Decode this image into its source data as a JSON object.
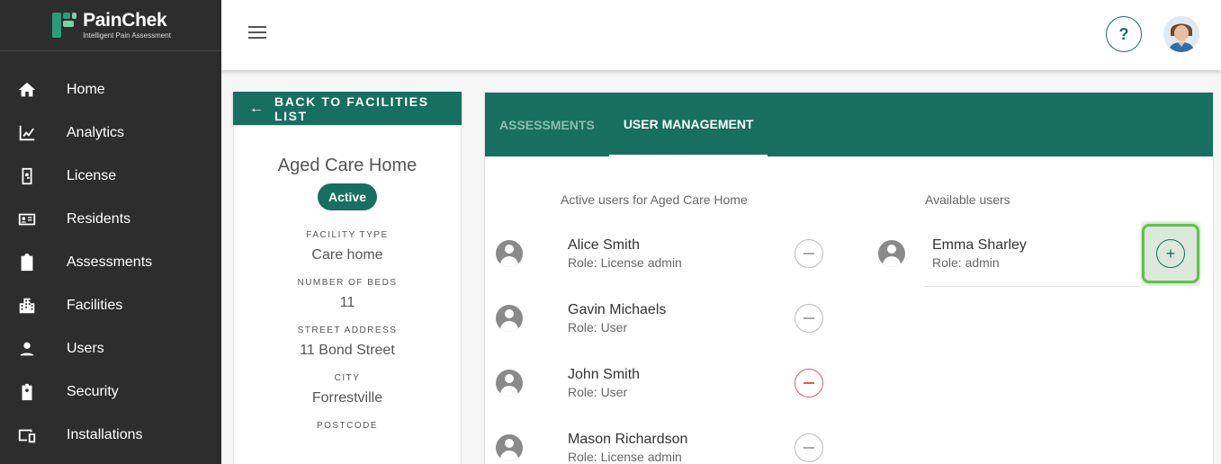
{
  "brand": {
    "name": "PainChek",
    "tagline": "Intelligent Pain Assessment"
  },
  "sidebar": {
    "items": [
      {
        "label": "Home",
        "icon": "home-icon"
      },
      {
        "label": "Analytics",
        "icon": "analytics-icon"
      },
      {
        "label": "License",
        "icon": "license-icon"
      },
      {
        "label": "Residents",
        "icon": "residents-icon"
      },
      {
        "label": "Assessments",
        "icon": "assessments-icon"
      },
      {
        "label": "Facilities",
        "icon": "facilities-icon"
      },
      {
        "label": "Users",
        "icon": "users-icon"
      },
      {
        "label": "Security",
        "icon": "security-icon"
      },
      {
        "label": "Installations",
        "icon": "installations-icon"
      }
    ]
  },
  "header": {
    "help_label": "?"
  },
  "facility": {
    "back_label": "BACK TO FACILITIES LIST",
    "name": "Aged Care Home",
    "status": "Active",
    "facility_type_label": "FACILITY TYPE",
    "facility_type": "Care home",
    "beds_label": "NUMBER OF BEDS",
    "beds": "11",
    "street_label": "STREET ADDRESS",
    "street": "11 Bond Street",
    "city_label": "CITY",
    "city": "Forrestville",
    "postcode_label": "POSTCODE"
  },
  "tabs": [
    {
      "label": "ASSESSMENTS",
      "active": false
    },
    {
      "label": "USER MANAGEMENT",
      "active": true
    }
  ],
  "active_users": {
    "title": "Active users for Aged Care Home",
    "users": [
      {
        "name": "Alice Smith",
        "role": "Role: License admin"
      },
      {
        "name": "Gavin Michaels",
        "role": "Role: User"
      },
      {
        "name": "John Smith",
        "role": "Role: User"
      },
      {
        "name": "Mason Richardson",
        "role": "Role: License admin"
      }
    ]
  },
  "available_users": {
    "title": "Available users",
    "users": [
      {
        "name": "Emma Sharley",
        "role": "Role: admin"
      }
    ]
  },
  "colors": {
    "primary": "#176f5f",
    "sidebar": "#2d2d2d",
    "highlight": "#5fc24a",
    "danger": "#e05a5a"
  }
}
